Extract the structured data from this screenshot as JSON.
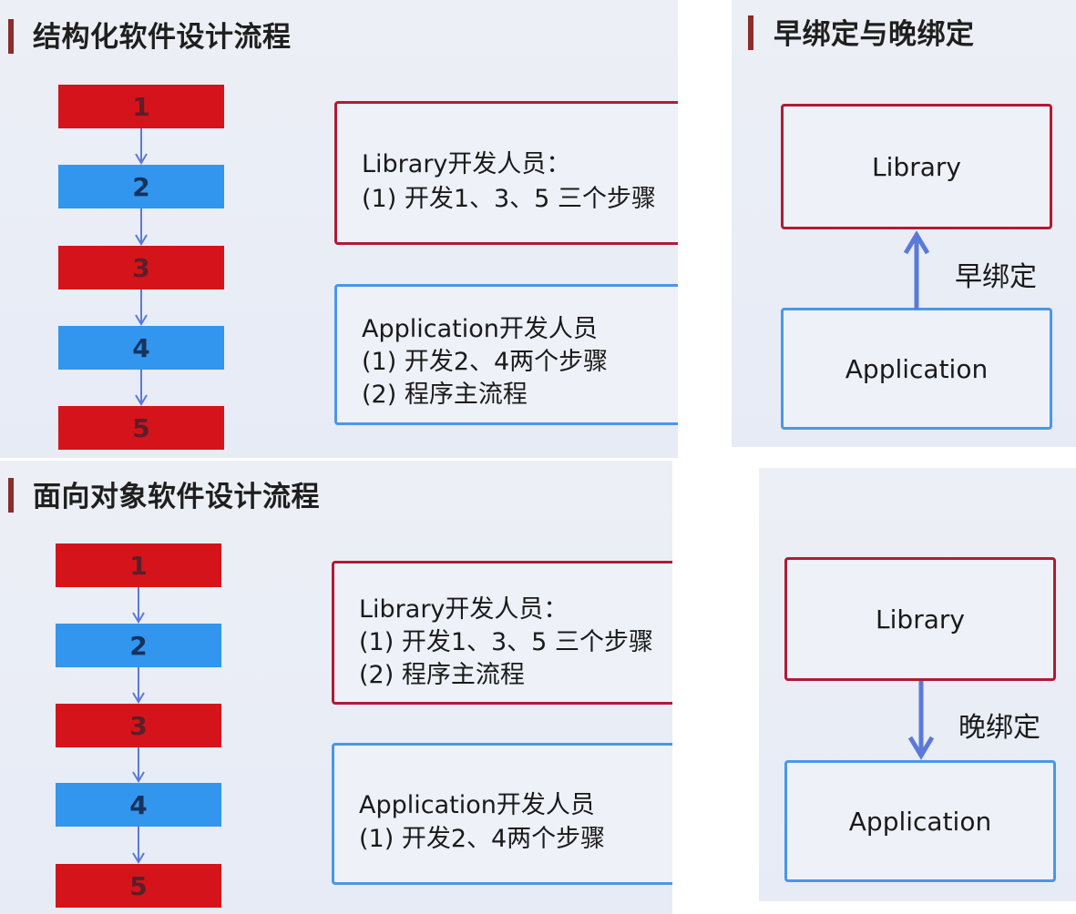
{
  "structured": {
    "title": "结构化软件设计流程",
    "steps": [
      "1",
      "2",
      "3",
      "4",
      "5"
    ],
    "library_box": {
      "lines": [
        "Library开发人员：",
        "(1) 开发1、3、5 三个步骤"
      ]
    },
    "application_box": {
      "lines": [
        "Application开发人员",
        "(1) 开发2、4两个步骤",
        "(2) 程序主流程"
      ]
    }
  },
  "object_oriented": {
    "title": "面向对象软件设计流程",
    "steps": [
      "1",
      "2",
      "3",
      "4",
      "5"
    ],
    "library_box": {
      "lines": [
        "Library开发人员：",
        "(1) 开发1、3、5 三个步骤",
        "(2) 程序主流程"
      ]
    },
    "application_box": {
      "lines": [
        "Application开发人员",
        "(1) 开发2、4两个步骤"
      ]
    }
  },
  "early_binding": {
    "title": "早绑定与晚绑定",
    "library": "Library",
    "application": "Application",
    "label": "早绑定"
  },
  "late_binding": {
    "library": "Library",
    "application": "Application",
    "label": "晚绑定"
  },
  "colors": {
    "step_red": "#d4141a",
    "step_blue": "#3396ee",
    "arrow": "#5b79d8",
    "library_border": "#b01b35",
    "application_border": "#4a97e8",
    "title_bar": "#8e2b2b"
  }
}
